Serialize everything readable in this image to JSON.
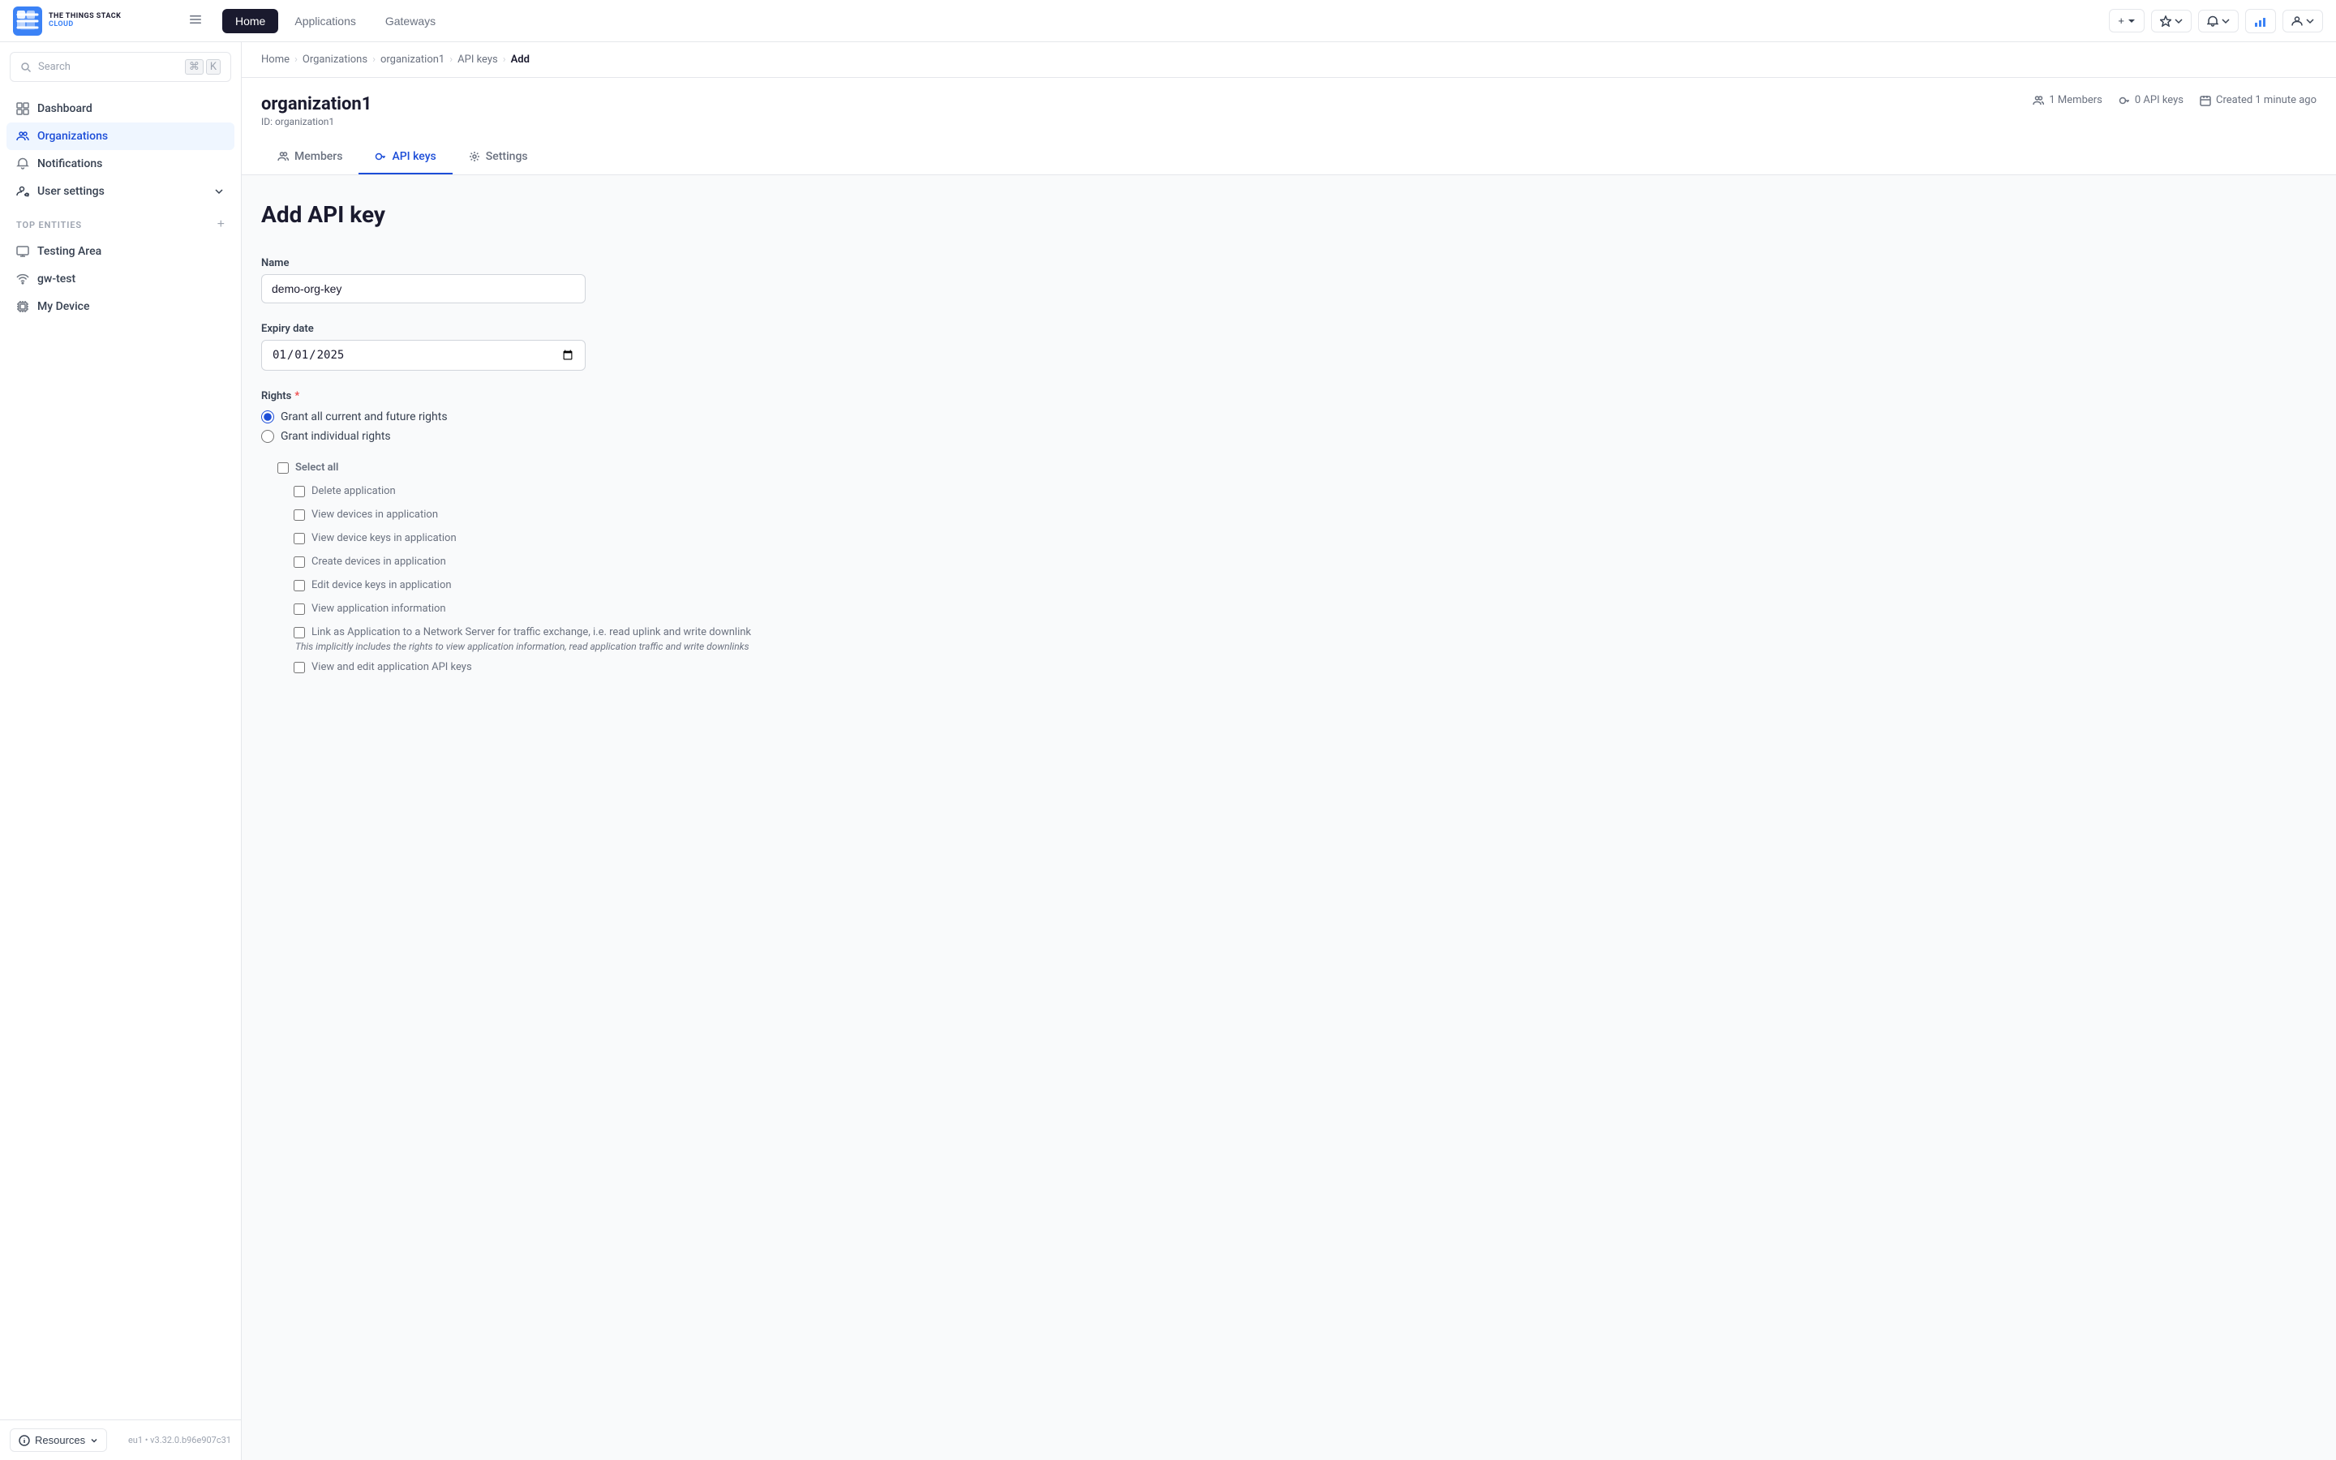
{
  "app": {
    "logo_top": "THE THINGS STACK",
    "logo_bottom": "CLOUD",
    "title": "The Things Stack Cloud"
  },
  "topnav": {
    "tabs": [
      {
        "id": "home",
        "label": "Home",
        "active": true
      },
      {
        "id": "applications",
        "label": "Applications",
        "active": false
      },
      {
        "id": "gateways",
        "label": "Gateways",
        "active": false
      }
    ],
    "actions": [
      {
        "id": "add",
        "label": "+",
        "has_chevron": true
      },
      {
        "id": "bookmarks",
        "label": "★",
        "has_chevron": true
      },
      {
        "id": "notifications",
        "label": "✉",
        "has_chevron": true
      },
      {
        "id": "status",
        "label": "📊",
        "has_chevron": false
      },
      {
        "id": "account",
        "label": "👤",
        "has_chevron": true
      }
    ]
  },
  "sidebar": {
    "search_placeholder": "Search",
    "search_shortcut1": "⌘",
    "search_shortcut2": "K",
    "nav_items": [
      {
        "id": "dashboard",
        "label": "Dashboard",
        "icon": "grid"
      },
      {
        "id": "organizations",
        "label": "Organizations",
        "icon": "users",
        "active": true
      },
      {
        "id": "notifications",
        "label": "Notifications",
        "icon": "bell"
      },
      {
        "id": "user-settings",
        "label": "User settings",
        "icon": "user-cog",
        "has_chevron": true
      }
    ],
    "section_label": "Top entities",
    "entities": [
      {
        "id": "testing-area",
        "label": "Testing Area",
        "icon": "monitor"
      },
      {
        "id": "gw-test",
        "label": "gw-test",
        "icon": "wifi"
      },
      {
        "id": "my-device",
        "label": "My Device",
        "icon": "cpu"
      }
    ],
    "resources_btn": "Resources",
    "version": "eu1 • v3.32.0.b96e907c31"
  },
  "breadcrumb": {
    "items": [
      {
        "id": "home",
        "label": "Home",
        "href": true
      },
      {
        "id": "organizations",
        "label": "Organizations",
        "href": true
      },
      {
        "id": "org1",
        "label": "organization1",
        "href": true
      },
      {
        "id": "apikeys",
        "label": "API keys",
        "href": true
      },
      {
        "id": "add",
        "label": "Add",
        "current": true
      }
    ]
  },
  "org": {
    "name": "organization1",
    "id_label": "ID: organization1",
    "meta": [
      {
        "id": "members",
        "icon": "users",
        "label": "1 Members"
      },
      {
        "id": "apikeys",
        "icon": "key",
        "label": "0 API keys"
      },
      {
        "id": "created",
        "icon": "calendar",
        "label": "Created 1 minute ago"
      }
    ],
    "tabs": [
      {
        "id": "members",
        "label": "Members",
        "icon": "users"
      },
      {
        "id": "apikeys",
        "label": "API keys",
        "icon": "key",
        "active": true
      },
      {
        "id": "settings",
        "label": "Settings",
        "icon": "settings"
      }
    ]
  },
  "form": {
    "page_title": "Add API key",
    "name_label": "Name",
    "name_value": "demo-org-key",
    "name_placeholder": "",
    "expiry_label": "Expiry date",
    "expiry_value": "2025-01-01",
    "rights_label": "Rights",
    "rights_required": true,
    "radio_options": [
      {
        "id": "all-rights",
        "label": "Grant all current and future rights",
        "checked": true
      },
      {
        "id": "individual-rights",
        "label": "Grant individual rights",
        "checked": false
      }
    ],
    "checkboxes": [
      {
        "id": "select-all",
        "label": "Select all",
        "indent": 0
      },
      {
        "id": "delete-app",
        "label": "Delete application",
        "indent": 1
      },
      {
        "id": "view-devices",
        "label": "View devices in application",
        "indent": 1
      },
      {
        "id": "view-device-keys",
        "label": "View device keys in application",
        "indent": 1
      },
      {
        "id": "create-devices",
        "label": "Create devices in application",
        "indent": 1
      },
      {
        "id": "edit-device-keys",
        "label": "Edit device keys in application",
        "indent": 1
      },
      {
        "id": "view-app-info",
        "label": "View application information",
        "indent": 1
      },
      {
        "id": "link-app",
        "label": "Link as Application to a Network Server for traffic exchange, i.e. read uplink and write downlink",
        "indent": 1,
        "has_note": true,
        "note": "This implicitly includes the rights to view application information, read application traffic and write downlinks"
      },
      {
        "id": "view-edit-api-keys",
        "label": "View and edit application API keys",
        "indent": 1
      }
    ]
  }
}
